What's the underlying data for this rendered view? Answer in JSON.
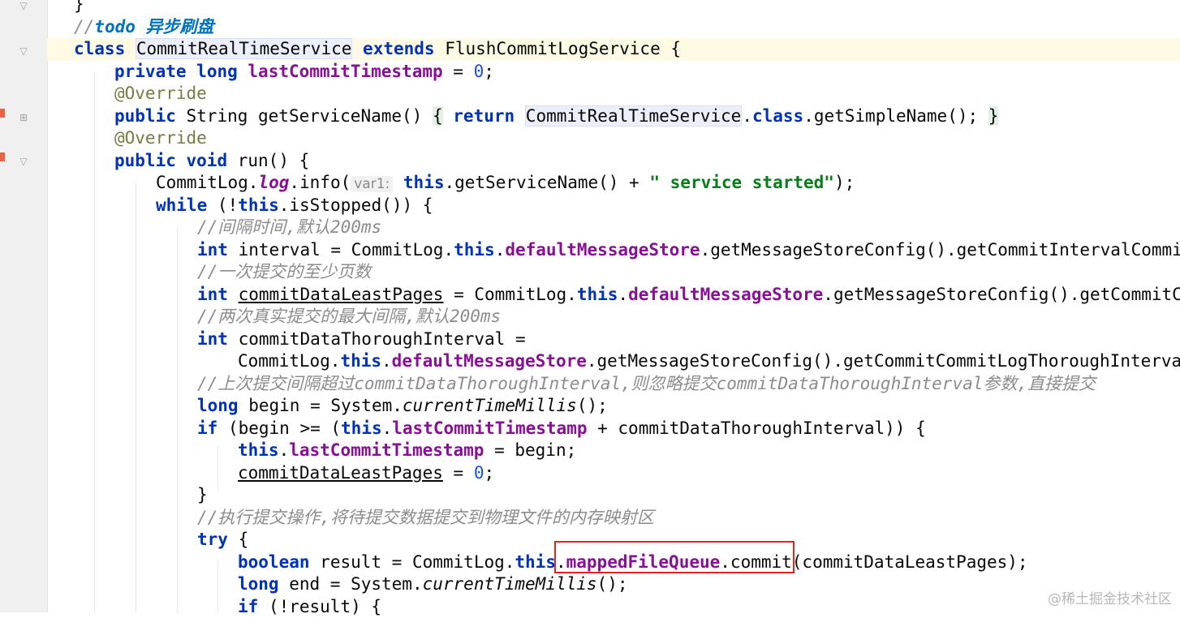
{
  "watermark": "@稀土掘金技术社区",
  "code": {
    "l0_brace": "}",
    "l1_slashes": "//",
    "l1_todo": "todo 异步刷盘",
    "l2_class": "class",
    "l2_name": "CommitRealTimeService",
    "l2_extends": "extends",
    "l2_super": "FlushCommitLogService {",
    "l3_private": "private",
    "l3_long": "long",
    "l3_field": "lastCommitTimestamp",
    "l3_eq": " = ",
    "l3_zero": "0",
    "l3_semi": ";",
    "l4_ann": "@Override",
    "l5_public": "public",
    "l5_sig": "String getServiceName()",
    "l5_open": "{",
    "l5_return": "return",
    "l5_cls": "CommitRealTimeService",
    "l5_dot": ".",
    "l5_classkw": "class",
    "l5_rest": ".getSimpleName();",
    "l5_close": "}",
    "l6_ann": "@Override",
    "l7_public": "public",
    "l7_void": "void",
    "l7_rest": "run() {",
    "l8_pre": "CommitLog.",
    "l8_log": "log",
    "l8_info": ".info(",
    "l8_hint": "var1:",
    "l8_this": "this",
    "l8_mid": ".getServiceName() + ",
    "l8_str": "\" service started\"",
    "l8_end": ");",
    "l9_while": "while",
    "l9_mid": "(!",
    "l9_this": "this",
    "l9_rest": ".isStopped()) {",
    "l10_cmt": "//间隔时间,默认200ms",
    "l11_int": "int",
    "l11_a": "interval = CommitLog.",
    "l11_this": "this",
    "l11_dot": ".",
    "l11_field": "defaultMessageStore",
    "l11_rest": ".getMessageStoreConfig().getCommitIntervalCommit",
    "l12_cmt": "//一次提交的至少页数",
    "l13_int": "int",
    "l13_var": "commitDataLeastPages",
    "l13_a": " = CommitLog.",
    "l13_this": "this",
    "l13_dot": ".",
    "l13_field": "defaultMessageStore",
    "l13_rest": ".getMessageStoreConfig().getCommitCo",
    "l14_cmt": "//两次真实提交的最大间隔,默认200ms",
    "l15_int": "int",
    "l15_rest": "commitDataThoroughInterval =",
    "l16_a": "CommitLog.",
    "l16_this": "this",
    "l16_dot": ".",
    "l16_field": "defaultMessageStore",
    "l16_rest": ".getMessageStoreConfig().getCommitCommitLogThoroughInterval",
    "l17_cmt": "//上次提交间隔超过commitDataThoroughInterval,则忽略提交commitDataThoroughInterval参数,直接提交",
    "l18_long": "long",
    "l18_a": "begin = System.",
    "l18_m": "currentTimeMillis",
    "l18_rest": "();",
    "l19_if": "if",
    "l19_a": "(begin >= (",
    "l19_this": "this",
    "l19_dot": ".",
    "l19_field": "lastCommitTimestamp",
    "l19_rest": " + commitDataThoroughInterval)) {",
    "l20_this": "this",
    "l20_dot": ".",
    "l20_field": "lastCommitTimestamp",
    "l20_rest": " = begin;",
    "l21_var": "commitDataLeastPages",
    "l21_eq": " = ",
    "l21_zero": "0",
    "l21_semi": ";",
    "l22_brace": "}",
    "l23_cmt": "//执行提交操作,将待提交数据提交到物理文件的内存映射区",
    "l24_try": "try",
    "l24_rest": " {",
    "l25_bool": "boolean",
    "l25_a": "result = CommitLog.",
    "l25_this": "this",
    "l25_dot": ".",
    "l25_field": "mappedFileQueue",
    "l25_rest": ".commit(commitDataLeastPages);",
    "l26_long": "long",
    "l26_a": "end = System.",
    "l26_m": "currentTimeMillis",
    "l26_rest": "();",
    "l27_if": "if",
    "l27_rest": "(!result) {"
  }
}
